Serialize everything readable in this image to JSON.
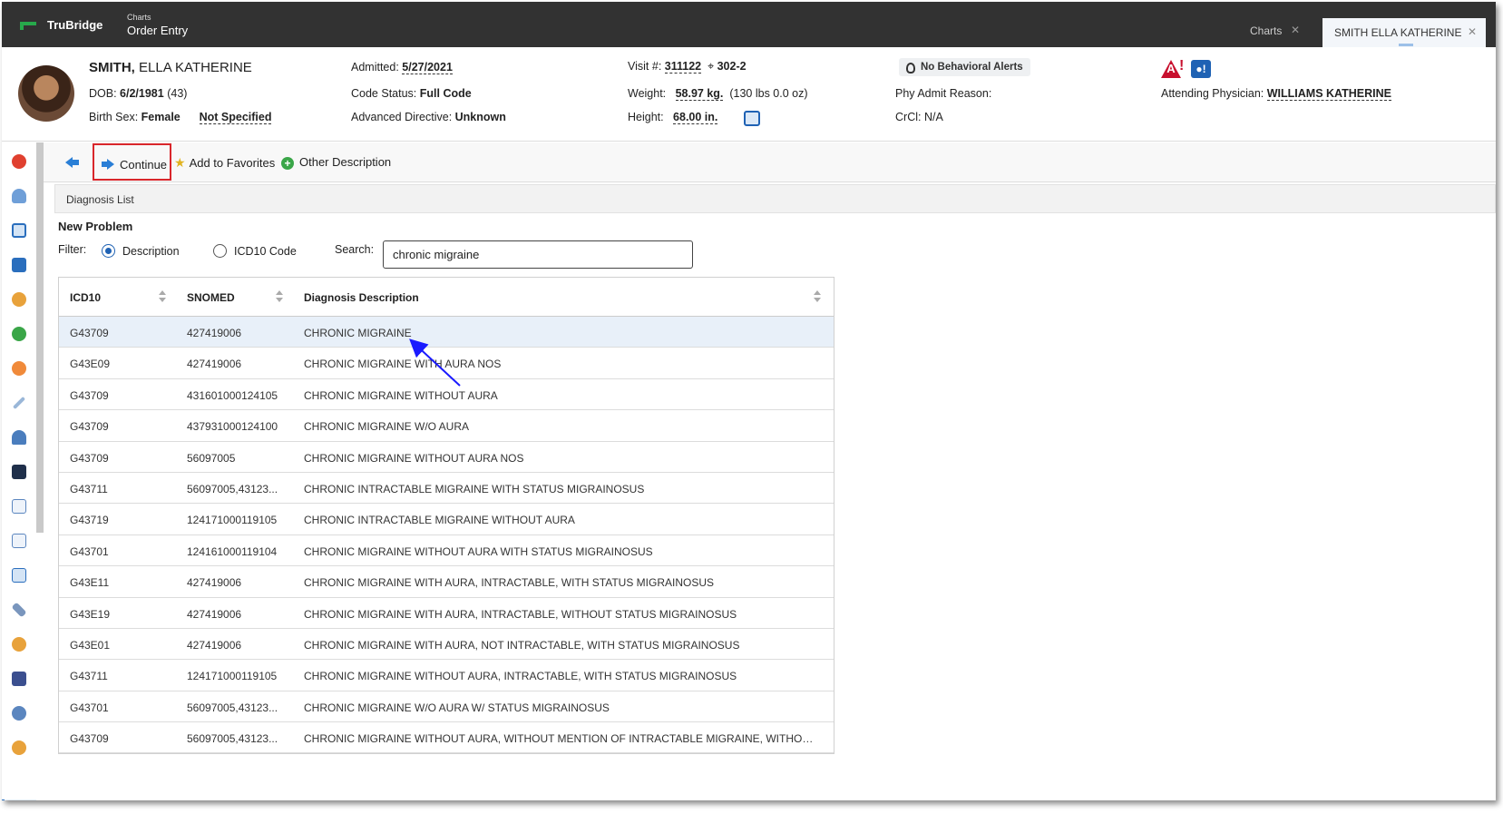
{
  "app": {
    "brand": "TruBridge",
    "breadcrumb_small": "Charts",
    "breadcrumb_main": "Order Entry",
    "tabs": [
      {
        "label": "Charts",
        "close": "✕"
      },
      {
        "label": "SMITH ELLA KATHERINE",
        "close": "✕"
      }
    ]
  },
  "patient": {
    "last_name": "SMITH,",
    "first_names": " ELLA KATHERINE",
    "dob_label": "DOB: ",
    "dob": "6/2/1981",
    "age": "(43)",
    "birth_sex_label": "Birth Sex: ",
    "birth_sex": "Female",
    "gender_identity": "Not Specified",
    "admitted_label": "Admitted: ",
    "admitted": "5/27/2021",
    "code_status_label": "Code Status: ",
    "code_status": "Full Code",
    "adv_directive_label": "Advanced Directive: ",
    "adv_directive": "Unknown",
    "visit_label": "Visit #: ",
    "visit": "311122",
    "room": "302-2",
    "weight_label": "Weight: ",
    "weight": "58.97 kg.",
    "weight_alt": "(130 lbs 0.0 oz)",
    "height_label": "Height: ",
    "height": "68.00 in.",
    "behavioral_alerts": "No Behavioral Alerts",
    "phy_admit_label": "Phy Admit Reason:",
    "crcl_label": "CrCl: ",
    "crcl": "N/A",
    "attending_label": "Attending Physician: ",
    "attending": "WILLIAMS KATHERINE"
  },
  "toolbar": {
    "continue_label": "Continue",
    "favorites_label": "Add to Favorites",
    "other_label": "Other Description"
  },
  "panel": {
    "title": "Diagnosis List",
    "section": "New Problem",
    "filter_label": "Filter:",
    "filter_options": [
      "Description",
      "ICD10 Code"
    ],
    "search_label": "Search:",
    "search_value": "chronic migraine"
  },
  "table": {
    "columns": [
      "ICD10",
      "SNOMED",
      "Diagnosis Description"
    ],
    "rows": [
      [
        "G43709",
        "427419006",
        "CHRONIC MIGRAINE"
      ],
      [
        "G43E09",
        "427419006",
        "CHRONIC MIGRAINE WITH AURA NOS"
      ],
      [
        "G43709",
        "431601000124105",
        "CHRONIC MIGRAINE WITHOUT AURA"
      ],
      [
        "G43709",
        "437931000124100",
        "CHRONIC MIGRAINE W/O AURA"
      ],
      [
        "G43709",
        "56097005",
        "CHRONIC MIGRAINE WITHOUT AURA NOS"
      ],
      [
        "G43711",
        "56097005,43123...",
        "CHRONIC INTRACTABLE MIGRAINE WITH STATUS MIGRAINOSUS"
      ],
      [
        "G43719",
        "124171000119105",
        "CHRONIC INTRACTABLE MIGRAINE WITHOUT AURA"
      ],
      [
        "G43701",
        "124161000119104",
        "CHRONIC MIGRAINE WITHOUT AURA WITH STATUS MIGRAINOSUS"
      ],
      [
        "G43E11",
        "427419006",
        "CHRONIC MIGRAINE WITH AURA, INTRACTABLE, WITH STATUS MIGRAINOSUS"
      ],
      [
        "G43E19",
        "427419006",
        "CHRONIC MIGRAINE WITH AURA, INTRACTABLE, WITHOUT STATUS MIGRAINOSUS"
      ],
      [
        "G43E01",
        "427419006",
        "CHRONIC MIGRAINE WITH AURA, NOT INTRACTABLE, WITH STATUS MIGRAINOSUS"
      ],
      [
        "G43711",
        "124171000119105",
        "CHRONIC MIGRAINE WITHOUT AURA, INTRACTABLE, WITH STATUS MIGRAINOSUS"
      ],
      [
        "G43701",
        "56097005,43123...",
        "CHRONIC MIGRAINE W/O AURA W/ STATUS MIGRAINOSUS"
      ],
      [
        "G43709",
        "56097005,43123...",
        "CHRONIC MIGRAINE WITHOUT AURA, WITHOUT MENTION OF INTRACTABLE MIGRAINE, WITHOUT ME..."
      ]
    ]
  },
  "colors": {
    "accent": "#1f62b4",
    "highlight_box": "#d9262b",
    "topbar": "#323232",
    "brand_green": "#27a94b"
  }
}
